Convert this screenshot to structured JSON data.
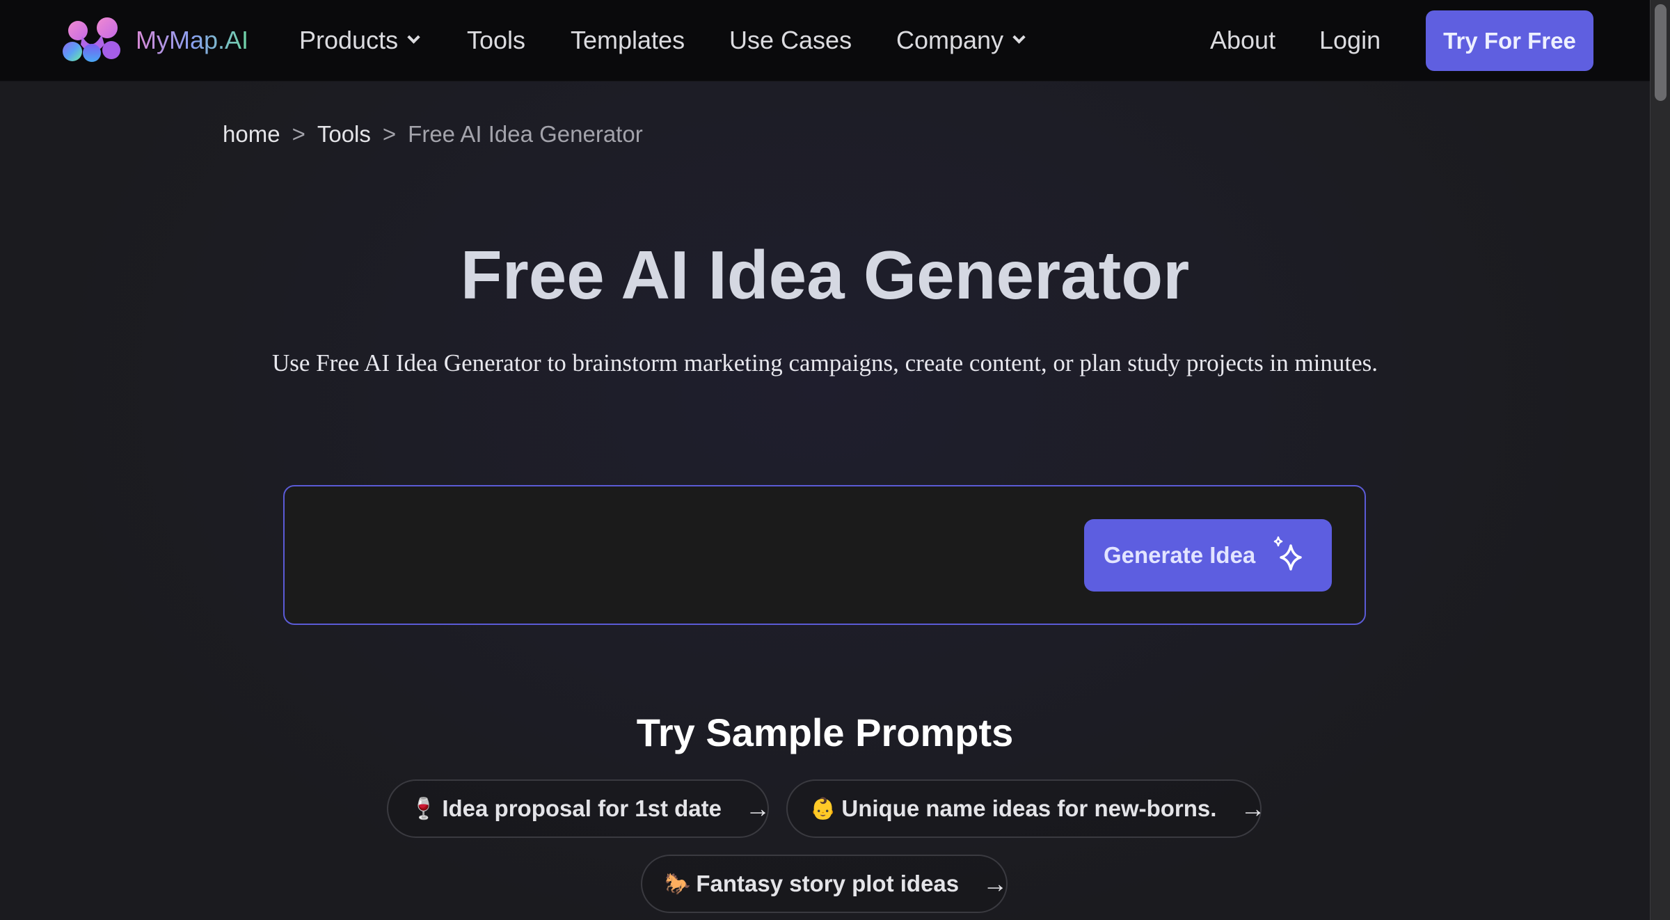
{
  "nav": {
    "brand": "MyMap.AI",
    "items": [
      {
        "label": "Products",
        "dropdown": true
      },
      {
        "label": "Tools",
        "dropdown": false
      },
      {
        "label": "Templates",
        "dropdown": false
      },
      {
        "label": "Use Cases",
        "dropdown": false
      },
      {
        "label": "Company",
        "dropdown": true
      }
    ],
    "about": "About",
    "login": "Login",
    "cta": "Try For Free"
  },
  "breadcrumb": {
    "items": [
      "home",
      "Tools",
      "Free AI Idea Generator"
    ],
    "separator": ">"
  },
  "hero": {
    "title": "Free AI Idea Generator",
    "subtitle": "Use Free AI Idea Generator to brainstorm marketing campaigns, create content, or plan study projects in minutes."
  },
  "input": {
    "value": "",
    "placeholder": "",
    "button_label": "Generate Idea",
    "button_icon": "sparkles-icon"
  },
  "samples": {
    "title": "Try Sample Prompts",
    "prompts": [
      {
        "emoji": "🍷",
        "label": "Idea proposal for 1st date"
      },
      {
        "emoji": "👶",
        "label": "Unique name ideas for new-borns."
      },
      {
        "emoji": "🐎",
        "label": "Fantasy story plot ideas"
      }
    ],
    "arrow": "→"
  },
  "colors": {
    "accent": "#5f5fe0",
    "nav_bg": "#0a0a0c",
    "input_border": "#5b5bd6"
  }
}
